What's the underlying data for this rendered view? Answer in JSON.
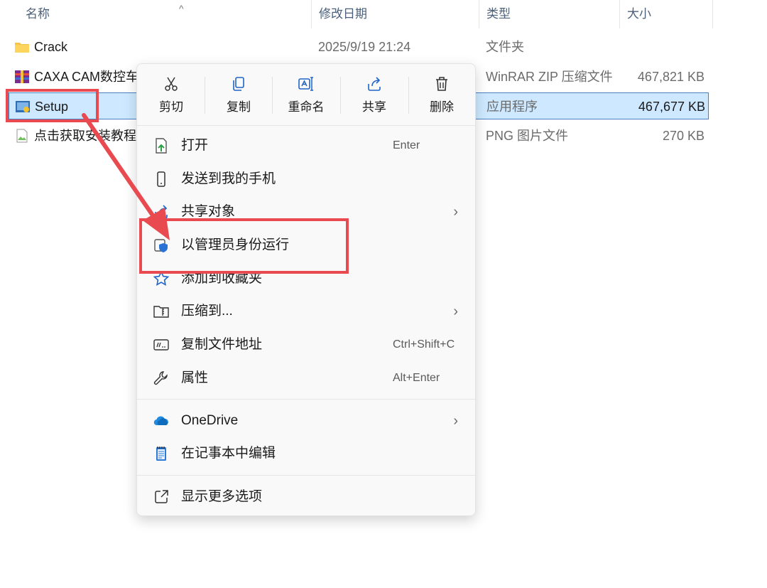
{
  "columns": {
    "name": "名称",
    "date": "修改日期",
    "type": "类型",
    "size": "大小"
  },
  "files": [
    {
      "name": "Crack",
      "date": "2025/9/19 21:24",
      "type": "文件夹",
      "size": "",
      "icon": "folder-icon"
    },
    {
      "name": "CAXA CAM数控车",
      "date": "",
      "type": "WinRAR ZIP 压缩文件",
      "size": "467,821 KB",
      "icon": "winrar-archive-icon"
    },
    {
      "name": "Setup",
      "date": "",
      "type": "应用程序",
      "size": "467,677 KB",
      "icon": "setup-exe-icon"
    },
    {
      "name": "点击获取安装教程",
      "date": "",
      "type": "PNG 图片文件",
      "size": "270 KB",
      "icon": "png-image-icon"
    }
  ],
  "menu": {
    "quick": [
      {
        "label": "剪切",
        "icon": "scissors-icon"
      },
      {
        "label": "复制",
        "icon": "copy-icon"
      },
      {
        "label": "重命名",
        "icon": "rename-icon"
      },
      {
        "label": "共享",
        "icon": "share-icon"
      },
      {
        "label": "删除",
        "icon": "trash-icon"
      }
    ],
    "items": [
      {
        "label": "打开",
        "shortcut": "Enter",
        "icon": "open-icon",
        "submenu": false
      },
      {
        "label": "发送到我的手机",
        "shortcut": "",
        "icon": "phone-icon",
        "submenu": false
      },
      {
        "label": "共享对象",
        "shortcut": "",
        "icon": "share-icon",
        "submenu": true
      },
      {
        "label": "以管理员身份运行",
        "shortcut": "",
        "icon": "admin-shield-icon",
        "submenu": false
      },
      {
        "label": "添加到收藏夹",
        "shortcut": "",
        "icon": "star-icon",
        "submenu": false
      },
      {
        "label": "压缩到...",
        "shortcut": "",
        "icon": "zip-folder-icon",
        "submenu": true
      },
      {
        "label": "复制文件地址",
        "shortcut": "Ctrl+Shift+C",
        "icon": "copy-path-icon",
        "submenu": false
      },
      {
        "label": "属性",
        "shortcut": "Alt+Enter",
        "icon": "wrench-icon",
        "submenu": false
      },
      {
        "label": "OneDrive",
        "shortcut": "",
        "icon": "onedrive-cloud-icon",
        "submenu": true
      },
      {
        "label": "在记事本中编辑",
        "shortcut": "",
        "icon": "notepad-icon",
        "submenu": false
      },
      {
        "label": "显示更多选项",
        "shortcut": "",
        "icon": "show-more-icon",
        "submenu": false
      }
    ],
    "chevron": "›"
  },
  "colors": {
    "accent_selection": "#cde8ff",
    "annotation_red": "#e84a4f"
  }
}
